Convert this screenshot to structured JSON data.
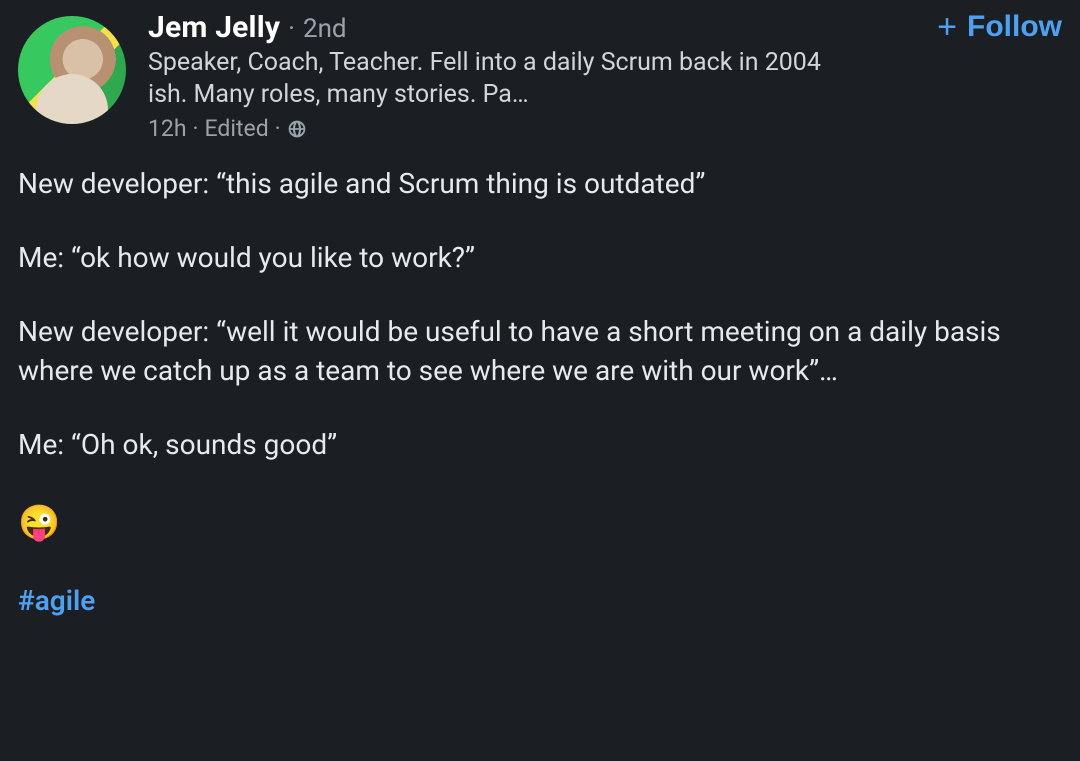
{
  "author": {
    "name": "Jem Jelly",
    "degree_separator": "·",
    "degree": "2nd",
    "headline": "Speaker, Coach, Teacher. Fell into a daily Scrum back in 2004 ish. Many roles, many stories. Pa…",
    "time": "12h",
    "edited": "Edited",
    "meta_separator": "·",
    "visibility_icon": "globe-icon"
  },
  "follow": {
    "plus": "+",
    "label": "Follow"
  },
  "body": {
    "p1": "New developer: “this agile and Scrum thing is outdated”",
    "p2": "Me: “ok how would you like to work?”",
    "p3": "New developer: “well it would be useful to have a short meeting on a daily basis where we catch up as a team to see where we are with our work”…",
    "p4": "Me: “Oh ok, sounds good”",
    "emoji": "😜",
    "hashtag": "#agile"
  }
}
